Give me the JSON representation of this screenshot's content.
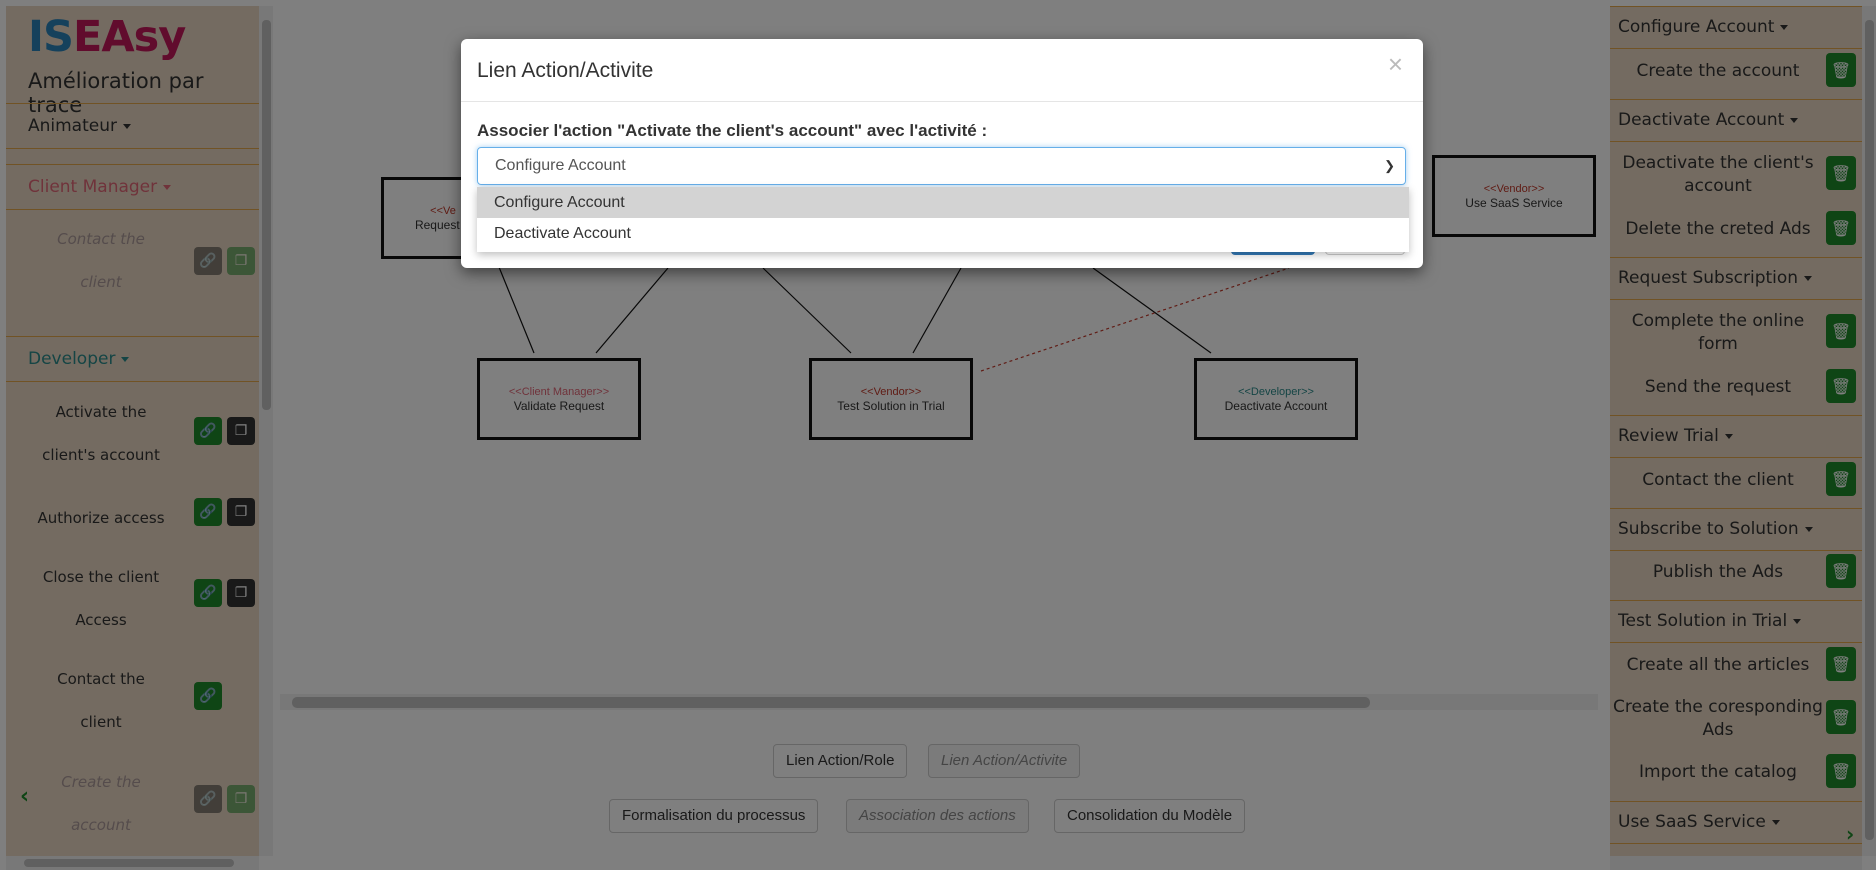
{
  "app": {
    "logo_part1": "IS",
    "logo_part2": "EAsy",
    "subtitle": "Amélioration par trace"
  },
  "left": {
    "roles": [
      {
        "label": "Animateur",
        "color": "#333333"
      },
      {
        "label": "Client Manager",
        "color": "#e06677"
      },
      {
        "label": "Developer",
        "color": "#2a8a8a"
      }
    ],
    "actions": [
      {
        "line1": "Contact the",
        "line2": "client"
      },
      {
        "line1": "Activate the",
        "line2": "client's account"
      },
      {
        "line1": "Authorize access",
        "line2": ""
      },
      {
        "line1": "Close the client",
        "line2": "Access"
      },
      {
        "line1": "Contact the",
        "line2": "client"
      },
      {
        "line1": "Create the",
        "line2": "account"
      }
    ]
  },
  "diagram": {
    "nodes": [
      {
        "stereo": "<<Ve",
        "name": "Request S",
        "stereo_color": "#c0392b"
      },
      {
        "stereo": "<<Vendor>>",
        "name": "Use SaaS Service",
        "stereo_color": "#c0392b"
      },
      {
        "stereo": "<<Client Manager>>",
        "name": "Validate Request",
        "stereo_color": "#e06677"
      },
      {
        "stereo": "<<Vendor>>",
        "name": "Test Solution in Trial",
        "stereo_color": "#c0392b"
      },
      {
        "stereo": "<<Developer>>",
        "name": "Deactivate Account",
        "stereo_color": "#2a8a8a"
      }
    ]
  },
  "bottom": {
    "lien_role": "Lien Action/Role",
    "lien_activite": "Lien Action/Activite",
    "formalisation": "Formalisation du processus",
    "association": "Association des actions",
    "consolidation": "Consolidation du Modèle"
  },
  "right": {
    "groups": [
      {
        "header": "Configure Account",
        "items": [
          "Create the account"
        ]
      },
      {
        "header": "Deactivate Account",
        "items": [
          "Deactivate the client's account",
          "Delete the creted Ads"
        ]
      },
      {
        "header": "Request Subscription",
        "items": [
          "Complete the online form",
          "Send the request"
        ]
      },
      {
        "header": "Review Trial",
        "items": [
          "Contact the client"
        ]
      },
      {
        "header": "Subscribe to Solution",
        "items": [
          "Publish the Ads"
        ]
      },
      {
        "header": "Test Solution in Trial",
        "items": [
          "Create all the articles",
          "Create the coresponding Ads",
          "Import the catalog"
        ]
      },
      {
        "header": "Use SaaS Service",
        "items": []
      }
    ]
  },
  "modal": {
    "title": "Lien Action/Activite",
    "close": "×",
    "label": "Associer l'action \"Activate the client's account\" avec l'activité :",
    "selected": "Configure Account",
    "options": [
      "Configure Account",
      "Deactivate Account"
    ]
  },
  "icons": {
    "link": "link-icon",
    "copy": "copy-icon",
    "trash": "trash-icon"
  }
}
